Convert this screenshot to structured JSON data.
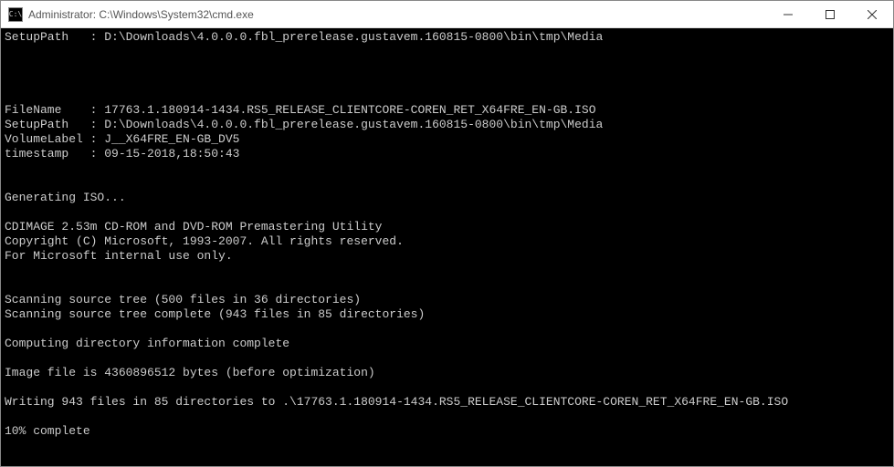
{
  "window": {
    "title": "Administrator: C:\\Windows\\System32\\cmd.exe",
    "icon_label": "C:\\"
  },
  "terminal": {
    "lines": [
      "SetupPath   : D:\\Downloads\\4.0.0.0.fbl_prerelease.gustavem.160815-0800\\bin\\tmp\\Media",
      "",
      "",
      "",
      "",
      "FileName    : 17763.1.180914-1434.RS5_RELEASE_CLIENTCORE-COREN_RET_X64FRE_EN-GB.ISO",
      "SetupPath   : D:\\Downloads\\4.0.0.0.fbl_prerelease.gustavem.160815-0800\\bin\\tmp\\Media",
      "VolumeLabel : J__X64FRE_EN-GB_DV5",
      "timestamp   : 09-15-2018,18:50:43",
      "",
      "",
      "Generating ISO...",
      "",
      "CDIMAGE 2.53m CD-ROM and DVD-ROM Premastering Utility",
      "Copyright (C) Microsoft, 1993-2007. All rights reserved.",
      "For Microsoft internal use only.",
      "",
      "",
      "Scanning source tree (500 files in 36 directories)",
      "Scanning source tree complete (943 files in 85 directories)",
      "",
      "Computing directory information complete",
      "",
      "Image file is 4360896512 bytes (before optimization)",
      "",
      "Writing 943 files in 85 directories to .\\17763.1.180914-1434.RS5_RELEASE_CLIENTCORE-COREN_RET_X64FRE_EN-GB.ISO",
      "",
      "10% complete"
    ]
  }
}
